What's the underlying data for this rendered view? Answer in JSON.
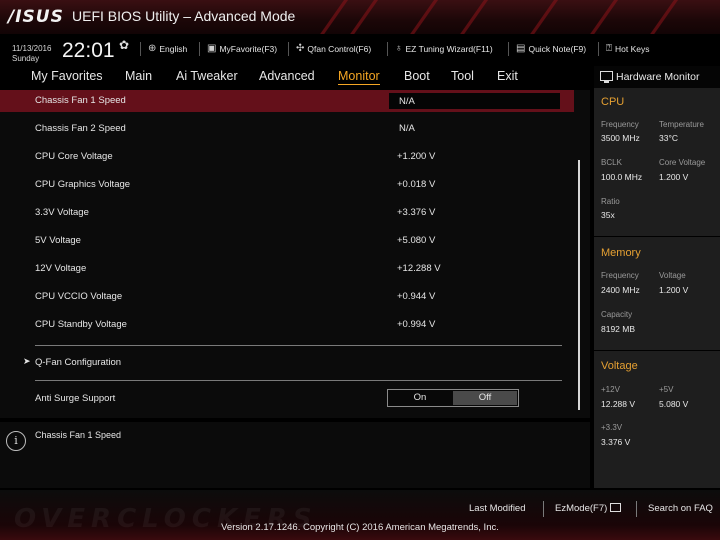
{
  "header": {
    "logo": "/ISUS",
    "title": "UEFI BIOS Utility – Advanced Mode"
  },
  "infobar": {
    "date": "11/13/2016",
    "day": "Sunday",
    "time": "22:01",
    "language": "English",
    "my_favorite": "MyFavorite(F3)",
    "qfan": "Qfan Control(F6)",
    "ez_tuning": "EZ Tuning Wizard(F11)",
    "quick_note": "Quick Note(F9)",
    "hot_keys": "Hot Keys"
  },
  "nav": {
    "tabs": [
      "My Favorites",
      "Main",
      "Ai Tweaker",
      "Advanced",
      "Monitor",
      "Boot",
      "Tool",
      "Exit"
    ],
    "active": "Monitor"
  },
  "main": {
    "rows": [
      {
        "label": "Chassis Fan 1 Speed",
        "value": "N/A"
      },
      {
        "label": "Chassis Fan 2 Speed",
        "value": "N/A"
      },
      {
        "label": "CPU Core Voltage",
        "value": "+1.200 V"
      },
      {
        "label": "CPU Graphics Voltage",
        "value": "+0.018 V"
      },
      {
        "label": "3.3V Voltage",
        "value": "+3.376 V"
      },
      {
        "label": "5V Voltage",
        "value": "+5.080 V"
      },
      {
        "label": "12V Voltage",
        "value": "+12.288 V"
      },
      {
        "label": "CPU VCCIO Voltage",
        "value": "+0.944 V"
      },
      {
        "label": "CPU Standby Voltage",
        "value": "+0.994 V"
      }
    ],
    "submenu": "Q-Fan Configuration",
    "anti_surge": {
      "label": "Anti Surge Support",
      "on": "On",
      "off": "Off",
      "selected": "Off"
    }
  },
  "help": {
    "text": "Chassis Fan 1 Speed"
  },
  "hw_monitor": {
    "title": "Hardware Monitor",
    "cpu": {
      "title": "CPU",
      "frequency_label": "Frequency",
      "frequency": "3500 MHz",
      "temperature_label": "Temperature",
      "temperature": "33°C",
      "bclk_label": "BCLK",
      "bclk": "100.0 MHz",
      "core_voltage_label": "Core Voltage",
      "core_voltage": "1.200 V",
      "ratio_label": "Ratio",
      "ratio": "35x"
    },
    "memory": {
      "title": "Memory",
      "frequency_label": "Frequency",
      "frequency": "2400 MHz",
      "voltage_label": "Voltage",
      "voltage": "1.200 V",
      "capacity_label": "Capacity",
      "capacity": "8192 MB"
    },
    "voltage": {
      "title": "Voltage",
      "v12_label": "+12V",
      "v12": "12.288 V",
      "v5_label": "+5V",
      "v5": "5.080 V",
      "v33_label": "+3.3V",
      "v33": "3.376 V"
    }
  },
  "footer": {
    "last_modified": "Last Modified",
    "ezmode": "EzMode(F7)",
    "search": "Search on FAQ",
    "copyright": "Version 2.17.1246. Copyright (C) 2016 American Megatrends, Inc.",
    "watermark": "OVERCLOCKERS"
  },
  "colors": {
    "accent": "#f5a623",
    "selection": "#64101a",
    "header_red": "#3a0f12",
    "monitor_bg": "#1e1e1e"
  }
}
